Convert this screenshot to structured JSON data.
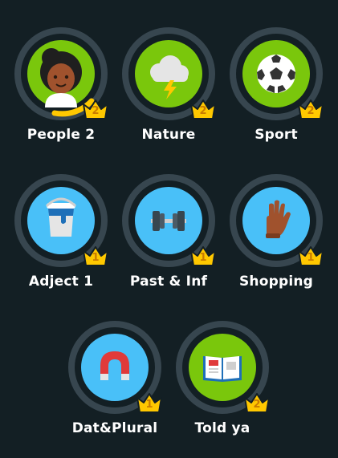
{
  "skills": [
    {
      "label": "People 2",
      "level": "2",
      "icon": "person-face-icon",
      "disc_color": "#7ac70c"
    },
    {
      "label": "Nature",
      "level": "2",
      "icon": "storm-cloud-icon",
      "disc_color": "#7ac70c"
    },
    {
      "label": "Sport",
      "level": "2",
      "icon": "soccer-ball-icon",
      "disc_color": "#7ac70c"
    },
    {
      "label": "Adject 1",
      "level": "1",
      "icon": "paint-bucket-icon",
      "disc_color": "#49c0f8"
    },
    {
      "label": "Past & Inf",
      "level": "1",
      "icon": "dumbbell-icon",
      "disc_color": "#49c0f8"
    },
    {
      "label": "Shopping",
      "level": "1",
      "icon": "glove-hand-icon",
      "disc_color": "#49c0f8"
    },
    {
      "label": "Dat&Plural",
      "level": "1",
      "icon": "magnet-icon",
      "disc_color": "#49c0f8"
    },
    {
      "label": "Told ya",
      "level": "2",
      "icon": "open-book-icon",
      "disc_color": "#7ac70c"
    }
  ],
  "colors": {
    "background": "#131f24",
    "ring": "#37464f",
    "progress": "#ffc800",
    "crown": "#ffc800",
    "label": "#ffffff"
  }
}
